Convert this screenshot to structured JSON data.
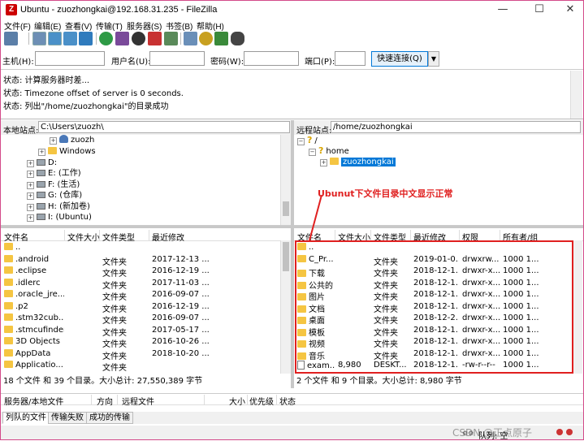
{
  "window": {
    "title": "Ubuntu - zuozhongkai@192.168.31.235 - FileZilla",
    "app_icon_letter": "Z",
    "minimize": "—",
    "maximize": "☐",
    "close": "✕"
  },
  "menu": [
    "文件(F)",
    "编辑(E)",
    "查看(V)",
    "传输(T)",
    "服务器(S)",
    "书签(B)",
    "帮助(H)"
  ],
  "quickconnect": {
    "host_label": "主机(H):",
    "user_label": "用户名(U):",
    "pass_label": "密码(W):",
    "port_label": "端口(P):",
    "connect_button": "快速连接(Q)",
    "dropdown": "▼"
  },
  "log": [
    "状态:  计算服务器时差...",
    "状态:  Timezone offset of server is 0 seconds.",
    "状态:  列出\"/home/zuozhongkai\"的目录成功"
  ],
  "local": {
    "site_label": "本地站点:",
    "site_path": "C:\\Users\\zuozh\\",
    "tree": [
      {
        "label": "zuozh",
        "type": "user",
        "indent": 3
      },
      {
        "label": "Windows",
        "type": "folder",
        "indent": 2
      },
      {
        "label": "D:",
        "type": "drive",
        "indent": 1
      },
      {
        "label": "E: (工作)",
        "type": "drive",
        "indent": 1
      },
      {
        "label": "F: (生活)",
        "type": "drive",
        "indent": 1
      },
      {
        "label": "G: (仓库)",
        "type": "drive",
        "indent": 1
      },
      {
        "label": "H: (新加卷)",
        "type": "drive",
        "indent": 1
      },
      {
        "label": "I: (Ubuntu)",
        "type": "drive",
        "indent": 1
      }
    ],
    "headers": [
      "文件名",
      "文件大小",
      "文件类型",
      "最近修改"
    ],
    "files": [
      {
        "name": "..",
        "size": "",
        "type": "",
        "modified": ""
      },
      {
        "name": ".android",
        "size": "",
        "type": "文件夹",
        "modified": "2017-12-13 ..."
      },
      {
        "name": ".eclipse",
        "size": "",
        "type": "文件夹",
        "modified": "2016-12-19 ..."
      },
      {
        "name": ".idlerc",
        "size": "",
        "type": "文件夹",
        "modified": "2017-11-03 ..."
      },
      {
        "name": ".oracle_jre...",
        "size": "",
        "type": "文件夹",
        "modified": "2016-09-07 ..."
      },
      {
        "name": ".p2",
        "size": "",
        "type": "文件夹",
        "modified": "2016-12-19 ..."
      },
      {
        "name": ".stm32cub...",
        "size": "",
        "type": "文件夹",
        "modified": "2016-09-07 ..."
      },
      {
        "name": ".stmcufinder",
        "size": "",
        "type": "文件夹",
        "modified": "2017-05-17 ..."
      },
      {
        "name": "3D Objects",
        "size": "",
        "type": "文件夹",
        "modified": "2016-10-26 ..."
      },
      {
        "name": "AppData",
        "size": "",
        "type": "文件夹",
        "modified": "2018-10-20 ..."
      },
      {
        "name": "Applicatio...",
        "size": "",
        "type": "文件夹",
        "modified": ""
      }
    ],
    "status": "18 个文件 和 39 个目录。大小总计: 27,550,389 字节"
  },
  "remote": {
    "site_label": "远程站点:",
    "site_path": "/home/zuozhongkai",
    "tree": [
      {
        "label": "/",
        "type": "unknown",
        "indent": 0
      },
      {
        "label": "home",
        "type": "unknown",
        "indent": 1
      },
      {
        "label": "zuozhongkai",
        "type": "folder-selected",
        "indent": 2
      }
    ],
    "headers": [
      "文件名",
      "文件大小",
      "文件类型",
      "最近修改",
      "权限",
      "所有者/组"
    ],
    "files": [
      {
        "name": "..",
        "size": "",
        "type": "",
        "modified": "",
        "perm": "",
        "owner": ""
      },
      {
        "name": "C_Pr...",
        "size": "",
        "type": "文件夹",
        "modified": "2019-01-0...",
        "perm": "drwxrw...",
        "owner": "1000 1..."
      },
      {
        "name": "下载",
        "size": "",
        "type": "文件夹",
        "modified": "2018-12-1...",
        "perm": "drwxr-x...",
        "owner": "1000 1..."
      },
      {
        "name": "公共的",
        "size": "",
        "type": "文件夹",
        "modified": "2018-12-1...",
        "perm": "drwxr-x...",
        "owner": "1000 1..."
      },
      {
        "name": "图片",
        "size": "",
        "type": "文件夹",
        "modified": "2018-12-1...",
        "perm": "drwxr-x...",
        "owner": "1000 1..."
      },
      {
        "name": "文档",
        "size": "",
        "type": "文件夹",
        "modified": "2018-12-1...",
        "perm": "drwxr-x...",
        "owner": "1000 1..."
      },
      {
        "name": "桌面",
        "size": "",
        "type": "文件夹",
        "modified": "2018-12-2...",
        "perm": "drwxr-x...",
        "owner": "1000 1..."
      },
      {
        "name": "模板",
        "size": "",
        "type": "文件夹",
        "modified": "2018-12-1...",
        "perm": "drwxr-x...",
        "owner": "1000 1..."
      },
      {
        "name": "视频",
        "size": "",
        "type": "文件夹",
        "modified": "2018-12-1...",
        "perm": "drwxr-x...",
        "owner": "1000 1..."
      },
      {
        "name": "音乐",
        "size": "",
        "type": "文件夹",
        "modified": "2018-12-1...",
        "perm": "drwxr-x...",
        "owner": "1000 1..."
      },
      {
        "name": "exam...",
        "size": "8,980",
        "type": "DESKT...",
        "modified": "2018-12-1...",
        "perm": "-rw-r--r--",
        "owner": "1000 1...",
        "is_file": true
      }
    ],
    "status": "2 个文件 和 9 个目录。大小总计: 8,980 字节"
  },
  "annotation": "Ubunut下文件目录中文显示正常",
  "queue": {
    "headers": [
      "服务器/本地文件",
      "方向",
      "远程文件",
      "大小",
      "优先级",
      "状态"
    ]
  },
  "tabs": [
    "列队的文件",
    "传输失败",
    "成功的传输"
  ],
  "bottom_status": {
    "queue": "队列: 空",
    "watermark": "CSDN @正点原子"
  },
  "colors": {
    "accent": "#0078d7",
    "annotation": "#e02020",
    "folder": "#f5c542"
  }
}
